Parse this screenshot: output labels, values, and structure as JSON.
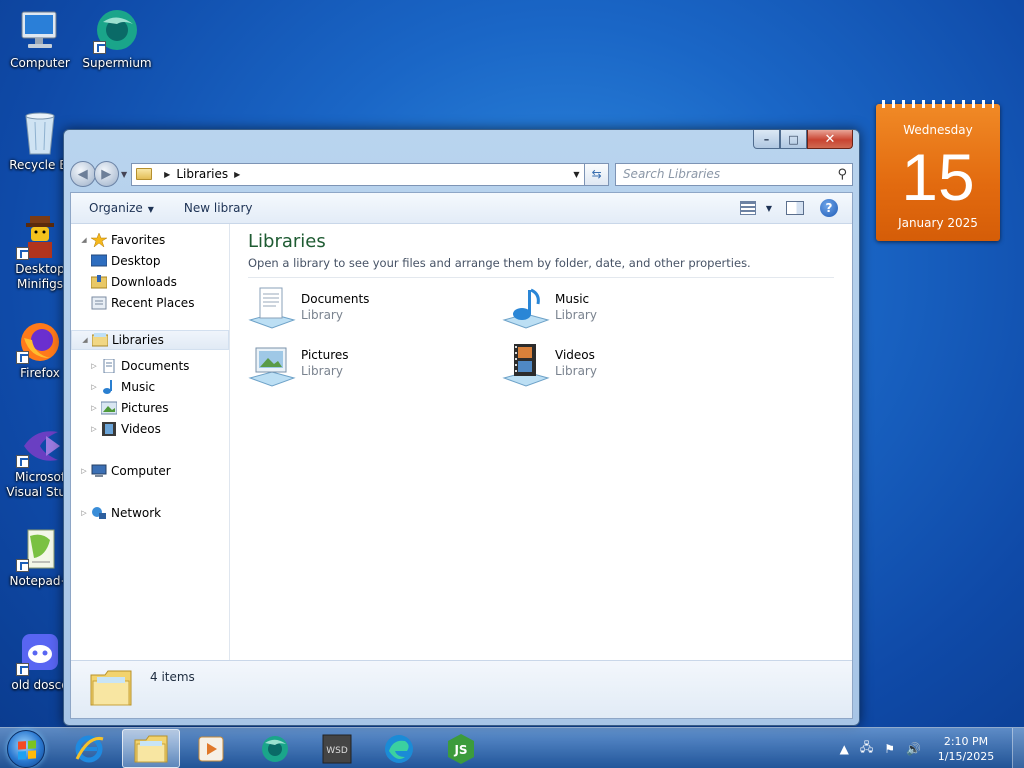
{
  "desktop": {
    "icons": [
      {
        "label": "Computer",
        "icon": "computer-icon"
      },
      {
        "label": "Supermium",
        "icon": "supermium-icon"
      },
      {
        "label": "Recycle Bi",
        "icon": "recycle-bin-icon"
      },
      {
        "label": "Desktop Minifigs",
        "icon": "minifig-icon"
      },
      {
        "label": "Firefox",
        "icon": "firefox-icon"
      },
      {
        "label": "Microsof Visual Stud",
        "icon": "visual-studio-icon"
      },
      {
        "label": "Notepad+",
        "icon": "notepad-plus-icon"
      },
      {
        "label": "old dosco",
        "icon": "discord-icon"
      }
    ]
  },
  "window": {
    "address": {
      "root": "Libraries"
    },
    "search": {
      "placeholder": "Search Libraries"
    },
    "toolbar": {
      "organize": "Organize",
      "new_library": "New library"
    },
    "nav": {
      "favorites": {
        "label": "Favorites",
        "items": [
          "Desktop",
          "Downloads",
          "Recent Places"
        ]
      },
      "libraries": {
        "label": "Libraries",
        "items": [
          "Documents",
          "Music",
          "Pictures",
          "Videos"
        ]
      },
      "computer": "Computer",
      "network": "Network"
    },
    "content": {
      "title": "Libraries",
      "subtitle": "Open a library to see your files and arrange them by folder, date, and other properties.",
      "items": [
        {
          "name": "Documents",
          "kind": "Library",
          "icon": "documents-library-icon"
        },
        {
          "name": "Music",
          "kind": "Library",
          "icon": "music-library-icon"
        },
        {
          "name": "Pictures",
          "kind": "Library",
          "icon": "pictures-library-icon"
        },
        {
          "name": "Videos",
          "kind": "Library",
          "icon": "videos-library-icon"
        }
      ]
    },
    "details": {
      "count": "4 items"
    }
  },
  "gadget": {
    "weekday": "Wednesday",
    "day": "15",
    "month_year": "January 2025"
  },
  "taskbar": {
    "apps": [
      "internet-explorer-icon",
      "explorer-icon",
      "media-player-icon",
      "supermium-icon",
      "wsd-icon",
      "edge-icon",
      "js-icon"
    ],
    "clock": {
      "time": "2:10 PM",
      "date": "1/15/2025"
    }
  },
  "colors": {
    "accent": "#1e5b32",
    "gadget": "#e26a0f",
    "desktop": "#1a66c6"
  }
}
